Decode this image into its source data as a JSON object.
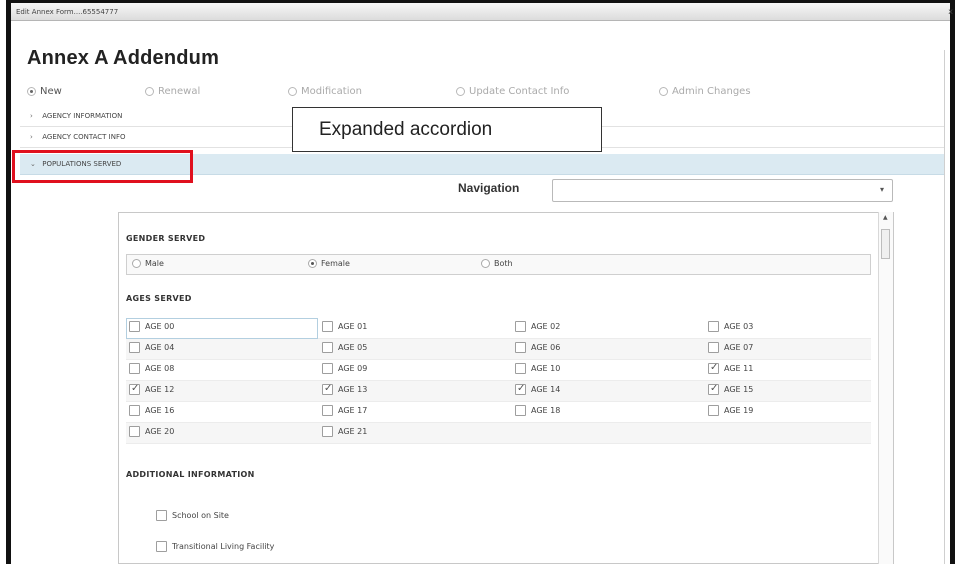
{
  "window": {
    "title": "Edit Annex Form....65554777",
    "close_glyph": "x"
  },
  "page": {
    "title": "Annex A Addendum"
  },
  "form_types": [
    {
      "label": "New",
      "checked": true
    },
    {
      "label": "Renewal",
      "checked": false
    },
    {
      "label": "Modification",
      "checked": false
    },
    {
      "label": "Update Contact Info",
      "checked": false
    },
    {
      "label": "Admin Changes",
      "checked": false
    }
  ],
  "accordion": [
    {
      "label": "AGENCY INFORMATION",
      "expanded": false,
      "chevron": "›"
    },
    {
      "label": "AGENCY CONTACT INFO",
      "expanded": false,
      "chevron": "›"
    },
    {
      "label": "POPULATIONS SERVED",
      "expanded": true,
      "chevron": "⌄"
    }
  ],
  "callout": {
    "text": "Expanded accordion"
  },
  "navigation": {
    "label": "Navigation",
    "value": "",
    "caret": "▾"
  },
  "gender": {
    "heading": "GENDER SERVED",
    "options": [
      {
        "label": "Male",
        "checked": false
      },
      {
        "label": "Female",
        "checked": true
      },
      {
        "label": "Both",
        "checked": false
      }
    ]
  },
  "ages": {
    "heading": "AGES SERVED",
    "rows": [
      [
        {
          "label": "AGE 00",
          "checked": false
        },
        {
          "label": "AGE 01",
          "checked": false
        },
        {
          "label": "AGE 02",
          "checked": false
        },
        {
          "label": "AGE 03",
          "checked": false
        }
      ],
      [
        {
          "label": "AGE 04",
          "checked": false
        },
        {
          "label": "AGE 05",
          "checked": false
        },
        {
          "label": "AGE 06",
          "checked": false
        },
        {
          "label": "AGE 07",
          "checked": false
        }
      ],
      [
        {
          "label": "AGE 08",
          "checked": false
        },
        {
          "label": "AGE 09",
          "checked": false
        },
        {
          "label": "AGE 10",
          "checked": false
        },
        {
          "label": "AGE 11",
          "checked": true
        }
      ],
      [
        {
          "label": "AGE 12",
          "checked": true
        },
        {
          "label": "AGE 13",
          "checked": true
        },
        {
          "label": "AGE 14",
          "checked": true
        },
        {
          "label": "AGE 15",
          "checked": true
        }
      ],
      [
        {
          "label": "AGE 16",
          "checked": false
        },
        {
          "label": "AGE 17",
          "checked": false
        },
        {
          "label": "AGE 18",
          "checked": false
        },
        {
          "label": "AGE 19",
          "checked": false
        }
      ],
      [
        {
          "label": "AGE 20",
          "checked": false
        },
        {
          "label": "AGE 21",
          "checked": false
        }
      ]
    ]
  },
  "additional": {
    "heading": "ADDITIONAL INFORMATION",
    "items": [
      {
        "label": "School on Site",
        "checked": false
      },
      {
        "label": "Transitional Living Facility",
        "checked": false
      }
    ]
  },
  "colors": {
    "highlight": "#e0101e",
    "expanded_row": "#dbeaf2"
  }
}
